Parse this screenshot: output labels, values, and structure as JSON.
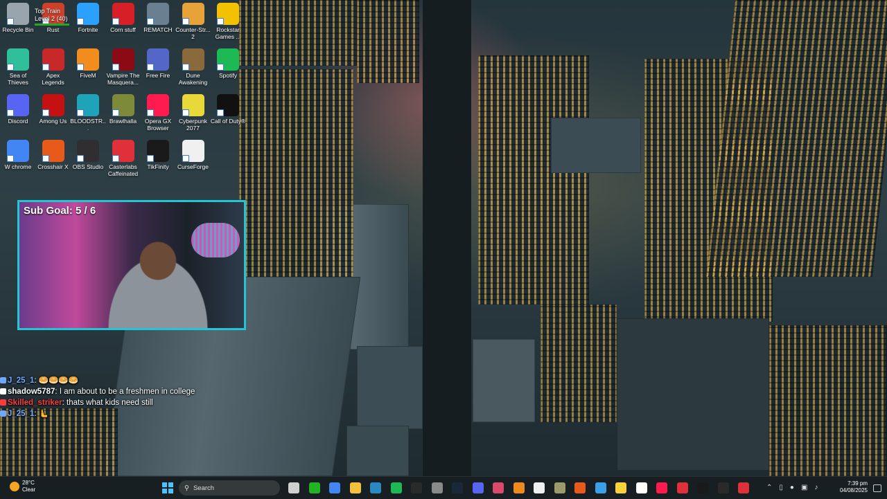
{
  "desktop_icons": [
    {
      "label": "Recycle Bin",
      "icon": "recycle-bin-icon",
      "color": "#9aa4ad"
    },
    {
      "label": "Rust",
      "icon": "rust-icon",
      "color": "#cd412b"
    },
    {
      "label": "Fortnite",
      "icon": "fortnite-icon",
      "color": "#2aa1ff"
    },
    {
      "label": "Corn stuff",
      "icon": "corn-stuff-icon",
      "color": "#d61f26"
    },
    {
      "label": "REMATCH",
      "icon": "rematch-icon",
      "color": "#6a7f8f"
    },
    {
      "label": "Counter-Str... 2",
      "icon": "counter-strike-icon",
      "color": "#e8a23a"
    },
    {
      "label": "Rockstar Games ...",
      "icon": "rockstar-icon",
      "color": "#f2c200"
    },
    {
      "label": "Sea of Thieves",
      "icon": "sea-of-thieves-icon",
      "color": "#2fbf9a"
    },
    {
      "label": "Apex Legends",
      "icon": "apex-icon",
      "color": "#c8282a"
    },
    {
      "label": "FiveM",
      "icon": "fivem-icon",
      "color": "#f28c1c"
    },
    {
      "label": "Vampire The Masquera...",
      "icon": "vampire-icon",
      "color": "#8b0a14"
    },
    {
      "label": "Free Fire",
      "icon": "free-fire-icon",
      "color": "#5466c7"
    },
    {
      "label": "Dune Awakening",
      "icon": "dune-icon",
      "color": "#8a6a3a"
    },
    {
      "label": "Spotify",
      "icon": "spotify-icon",
      "color": "#1db954"
    },
    {
      "label": "Discord",
      "icon": "discord-icon",
      "color": "#5865f2"
    },
    {
      "label": "Among Us",
      "icon": "among-us-icon",
      "color": "#c51111"
    },
    {
      "label": "BLOODSTR...",
      "icon": "bloodstrike-icon",
      "color": "#1fa3b8"
    },
    {
      "label": "Brawlhalla",
      "icon": "brawlhalla-icon",
      "color": "#7c8a3a"
    },
    {
      "label": "Opera GX Browser",
      "icon": "opera-gx-icon",
      "color": "#ff1b4d"
    },
    {
      "label": "Cyberpunk 2077",
      "icon": "cyberpunk-icon",
      "color": "#e9d83a"
    },
    {
      "label": "Call of Duty®",
      "icon": "call-of-duty-icon",
      "color": "#111111"
    },
    {
      "label": "W chrome",
      "icon": "chrome-icon",
      "color": "#4285f4"
    },
    {
      "label": "Crosshair X",
      "icon": "crosshair-x-icon",
      "color": "#e85a1a"
    },
    {
      "label": "OBS Studio",
      "icon": "obs-studio-icon",
      "color": "#302e31"
    },
    {
      "label": "Casterlabs Caffeinated",
      "icon": "casterlabs-icon",
      "color": "#e0303a"
    },
    {
      "label": "TikFinity",
      "icon": "tikfinity-icon",
      "color": "#1a1a1a"
    },
    {
      "label": "CurseForge",
      "icon": "curseforge-icon",
      "color": "#f0f0f0"
    }
  ],
  "top_train": {
    "line1": "Top Train",
    "line2": "Level 2 (40)"
  },
  "webcam": {
    "goal_label": "Sub Goal:",
    "goal_value": "5 / 6"
  },
  "chat": [
    {
      "user": "J_25_1",
      "sep": ":",
      "message": "🥯🥯🥯🥯",
      "color": "#6fa8ff"
    },
    {
      "user": "shadow5787",
      "sep": ":",
      "message": "I am about to be a freshmen in college",
      "color": "#ffffff"
    },
    {
      "user": "Skilled_striker",
      "sep": ":",
      "message": "thats what kids need still",
      "color": "#ff3b3b"
    },
    {
      "user": "J_25_1",
      "sep": ":",
      "message": "🫷",
      "color": "#6fa8ff"
    }
  ],
  "taskbar": {
    "weather_temp": "28°C",
    "weather_desc": "Clear",
    "search_placeholder": "Search",
    "time": "7:39 pm",
    "date": "04/08/2025",
    "apps": [
      {
        "name": "task-view-icon",
        "color": "#d0d0d0"
      },
      {
        "name": "xbox-icon",
        "color": "#21b323"
      },
      {
        "name": "chrome-taskbar-icon",
        "color": "#4285f4"
      },
      {
        "name": "file-explorer-icon",
        "color": "#f3c13a"
      },
      {
        "name": "visual-studio-icon",
        "color": "#2b89c2"
      },
      {
        "name": "spotify-taskbar-icon",
        "color": "#1db954"
      },
      {
        "name": "epic-games-icon",
        "color": "#2a2a2a"
      },
      {
        "name": "ubisoft-icon",
        "color": "#8a8a8a"
      },
      {
        "name": "steam-icon",
        "color": "#1b2838"
      },
      {
        "name": "discord-taskbar-icon",
        "color": "#5865f2"
      },
      {
        "name": "media-app-icon",
        "color": "#d94a6a"
      },
      {
        "name": "vlc-icon",
        "color": "#f08a1c"
      },
      {
        "name": "curseforge-taskbar-icon",
        "color": "#f0f0f0"
      },
      {
        "name": "settings-icon",
        "color": "#9a9a6a"
      },
      {
        "name": "crosshair-taskbar-icon",
        "color": "#e85a1a"
      },
      {
        "name": "photos-icon",
        "color": "#3aa0e8"
      },
      {
        "name": "sticky-notes-icon",
        "color": "#f5d33a"
      },
      {
        "name": "obs-taskbar-icon",
        "color": "#ffffff"
      },
      {
        "name": "opera-gx-taskbar-icon",
        "color": "#ff1b4d"
      },
      {
        "name": "casterlabs-taskbar-icon",
        "color": "#e0303a"
      },
      {
        "name": "tikfinity-taskbar-icon",
        "color": "#1a1a1a"
      },
      {
        "name": "xbox-gamebar-icon",
        "color": "#2a2a2a"
      },
      {
        "name": "casterlabs-caffeinated-taskbar-icon",
        "color": "#e0303a"
      }
    ]
  }
}
